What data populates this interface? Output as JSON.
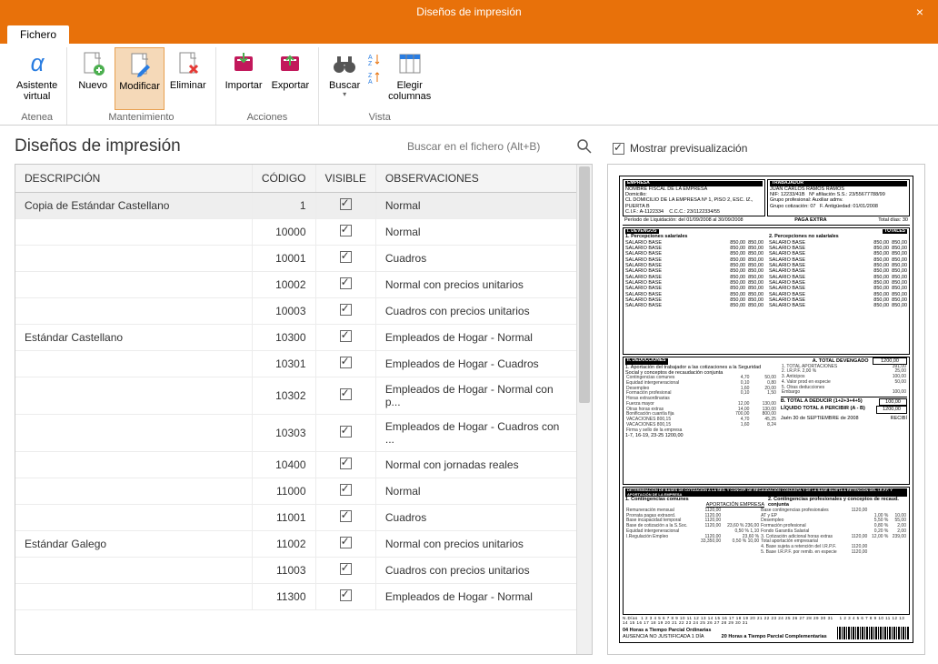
{
  "window": {
    "title": "Diseños de impresión",
    "close_icon": "×"
  },
  "tabs": {
    "file": "Fichero"
  },
  "ribbon": {
    "atenea": {
      "label": "Asistente\nvirtual",
      "group": "Atenea"
    },
    "maint": {
      "nuevo": "Nuevo",
      "modificar": "Modificar",
      "eliminar": "Eliminar",
      "group": "Mantenimiento"
    },
    "acciones": {
      "importar": "Importar",
      "exportar": "Exportar",
      "group": "Acciones"
    },
    "vista": {
      "buscar": "Buscar",
      "elegir": "Elegir\ncolumnas",
      "group": "Vista"
    }
  },
  "panel": {
    "title": "Diseños de impresión",
    "search_placeholder": "Buscar en el fichero (Alt+B)"
  },
  "columns": {
    "desc": "DESCRIPCIÓN",
    "code": "CÓDIGO",
    "visible": "VISIBLE",
    "obs": "OBSERVACIONES"
  },
  "rows": [
    {
      "desc": "Copia de Estándar Castellano",
      "code": "1",
      "visible": true,
      "obs": "Normal",
      "selected": true,
      "groupStart": true
    },
    {
      "desc": "",
      "code": "10000",
      "visible": true,
      "obs": "Normal",
      "groupStart": true
    },
    {
      "desc": "",
      "code": "10001",
      "visible": true,
      "obs": "Cuadros"
    },
    {
      "desc": "",
      "code": "10002",
      "visible": true,
      "obs": "Normal con precios unitarios"
    },
    {
      "desc": "",
      "code": "10003",
      "visible": true,
      "obs": "Cuadros con precios unitarios"
    },
    {
      "desc": "Estándar Castellano",
      "code": "10300",
      "visible": true,
      "obs": "Empleados de Hogar - Normal"
    },
    {
      "desc": "",
      "code": "10301",
      "visible": true,
      "obs": "Empleados de Hogar - Cuadros"
    },
    {
      "desc": "",
      "code": "10302",
      "visible": true,
      "obs": "Empleados de Hogar - Normal con p..."
    },
    {
      "desc": "",
      "code": "10303",
      "visible": true,
      "obs": "Empleados de Hogar - Cuadros con ..."
    },
    {
      "desc": "",
      "code": "10400",
      "visible": true,
      "obs": "Normal con jornadas reales"
    },
    {
      "desc": "",
      "code": "11000",
      "visible": true,
      "obs": "Normal",
      "groupStart": true
    },
    {
      "desc": "",
      "code": "11001",
      "visible": true,
      "obs": "Cuadros"
    },
    {
      "desc": "Estándar Galego",
      "code": "11002",
      "visible": true,
      "obs": "Normal con precios unitarios"
    },
    {
      "desc": "",
      "code": "11003",
      "visible": true,
      "obs": "Cuadros con precios unitarios"
    },
    {
      "desc": "",
      "code": "11300",
      "visible": true,
      "obs": "Empleados de Hogar - Normal"
    }
  ],
  "preview": {
    "toggle_label": "Mostrar previsualización",
    "checked": true,
    "empresa_title": "EMPRESA",
    "empresa_name": "NOMBRE FISCAL DE LA EMPRESA",
    "empresa_dom": "Domicilio:",
    "empresa_dom_val": "CL DOMICILIO DE LA EMPRESA Nº 1, PISO 2, ESC. IZ., PUERTA B",
    "empresa_cif": "C.I.F.:  A-1122334",
    "empresa_ccc": "C.C.C.:  23/1122334/55",
    "trab_title": "TRABAJADOR",
    "trab_name": "JUAN CARLOS RAMOS RAMOS",
    "trab_nif": "NIF: 12233/41B",
    "trab_afil": "Nº afiliación S.S.: 23/55677788/99",
    "trab_grupo": "Grupo profesional:  Auxiliar admv.",
    "trab_cot": "Grupo cotización:  07",
    "trab_ant": "F. Antigüedad:  01/01/2008",
    "periodo": "Período de Liquidación: del  01/09/2008  al  30/09/2008",
    "paga": "PAGA EXTRA",
    "total_dias": "Total días:  30",
    "devengos": "I. DEVENGOS",
    "totales": "TOTALES",
    "perc_sal": "1. Percepciones salariales",
    "perc_nosal": "2. Percepciones no salariales",
    "salario_base": "SALARIO BASE",
    "deducciones": "II. DEDUCCIONES",
    "total_devengado": "A. TOTAL DEVENGADO",
    "total_devengado_val": "1200,00",
    "aportacion": "1. Aportación del trabajador a las cotizaciones a la Seguridad",
    "aportacion2": "Social y conceptos de recaudación conjunta",
    "items_ded": [
      [
        "Contingencias comunes",
        "4,70",
        "50,00"
      ],
      [
        "Equidad intergeneracional",
        "0,10",
        "0,80"
      ],
      [
        "Desempleo",
        "1,60",
        "20,00"
      ],
      [
        "Formación profesional",
        "0,10",
        "1,50"
      ],
      [
        "Horas extraordinarias",
        "",
        ""
      ],
      [
        "  Fuerza mayor",
        "12,00",
        "130,00"
      ],
      [
        "  Otras horas extras",
        "14,00",
        "130,00"
      ],
      [
        "Bonificación cuantía fija",
        "700,00",
        "800,00"
      ],
      [
        "VACACIONES   800,15",
        "4,70",
        "45,25"
      ],
      [
        "VACACIONES   800,15",
        "1,60",
        "8,24"
      ],
      [
        "Firma y sello de la empresa",
        "",
        ""
      ]
    ],
    "right_ded": [
      [
        "1.  TOTAL APORTACIONES",
        "391,00"
      ],
      [
        "2.  I.R.P.F.          2,00  %",
        "25,00"
      ],
      [
        "3.  Anticipos",
        "100,00"
      ],
      [
        "4.  Valor prod en especie",
        "50,00"
      ],
      [
        "5.  Otras deducciones",
        ""
      ],
      [
        "     Embargo",
        "100,00"
      ]
    ],
    "total_deducir": "B. TOTAL A DEDUCIR (1+2+3+4+5)",
    "total_deducir_val": "100,00",
    "liquido": "LÍQUIDO TOTAL A PERCIBIR (A - B)",
    "liquido_val": "1200,00",
    "jaen": "Jaén 30  de SEPTIEMBRE  de  2008",
    "recibi": "RECIBÍ",
    "fechas": "1-7, 16-19, 23-25     1200,00",
    "det_title": "DETERMINACIÓN DE BASES DE COTIZACIÓN A LA SEG. Y CONCEP. DE RECAUDACIÓN CONJUNTA Y DE LA BASE SUJETA A RETENCIÓN DEL I.R.P.F. Y APORTACIÓN DE LA EMPRESA",
    "cont_com": "1. Contingencias comunes",
    "cont_prof": "2. Contingencias profesionales y conceptos de recaud. conjunta",
    "aport_emp": "APORTACIÓN EMPRESA",
    "bottom_rows": [
      [
        "Remuneración mensual",
        "1120,00",
        "",
        "Base contingencias profesionales",
        "1120,00",
        "",
        ""
      ],
      [
        "Prorrata pagas extraord.",
        "1120,00",
        "",
        "AT y EP",
        "",
        "1,00 %",
        "10,00"
      ],
      [
        "Base incapacidad temporal",
        "1120,00",
        "",
        "Desempleo",
        "",
        "5,50 %",
        "55,00"
      ],
      [
        "Base de cotización a la S.Soc.",
        "1120,00",
        "23,60 %   236,00",
        "Formación profesional",
        "",
        "0,80 %",
        "2,00"
      ],
      [
        "Equidad intergeneracional",
        "",
        "0,50 %     1,10",
        "Fondo Garantía Salarial",
        "",
        "0,20 %",
        "2,00"
      ],
      [
        "I.Regulación Empleo",
        "1120,00",
        "23,60 %",
        "3. Cotización adicional horas extras",
        "1120,00",
        "12,00 %",
        "239,00"
      ],
      [
        "",
        "33,350,00",
        "0,50 %   10,00",
        "Total aportación empresarial",
        "",
        "",
        ""
      ],
      [
        "",
        "",
        "",
        "4. Base sujeta a retención del I.R.P.F.",
        "1120,00",
        "",
        ""
      ],
      [
        "",
        "",
        "",
        "5. Base I.R.P.F. por remib. en especie",
        "1120,00",
        "",
        ""
      ]
    ],
    "footer1": "04 Horas a Tiempo Parcial Ordinarias",
    "footer2": "20 Horas a Tiempo Parcial Complementarias",
    "footer3": "AUSENCIA NO JUSTIFICADA 1 DÍA"
  }
}
